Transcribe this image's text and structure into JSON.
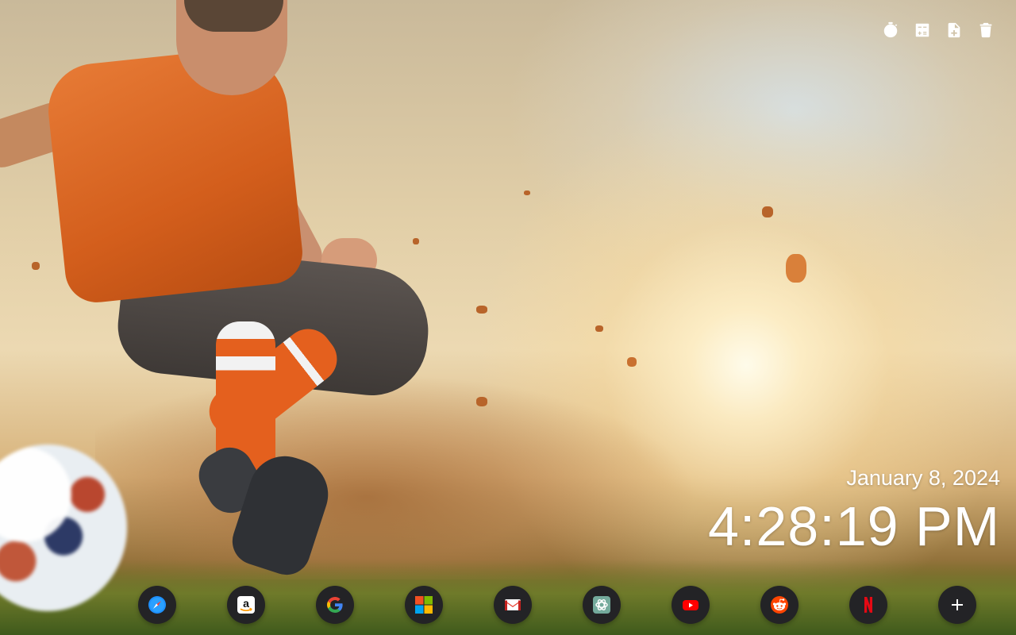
{
  "toolbar": {
    "items": [
      {
        "icon": "stopwatch-icon"
      },
      {
        "icon": "calculator-icon"
      },
      {
        "icon": "add-file-icon"
      },
      {
        "icon": "trash-icon"
      }
    ]
  },
  "clock": {
    "date": "January 8, 2024",
    "time": "4:28:19 PM"
  },
  "dock": {
    "items": [
      {
        "name": "safari",
        "icon": "compass-icon",
        "color": "#1e90ff"
      },
      {
        "name": "amazon",
        "icon": "amazon-icon",
        "color": "#ff9900"
      },
      {
        "name": "google",
        "icon": "google-icon",
        "color": "#4285f4"
      },
      {
        "name": "microsoft",
        "icon": "microsoft-icon",
        "color": "#f25022"
      },
      {
        "name": "gmail",
        "icon": "gmail-icon",
        "color": "#ea4335"
      },
      {
        "name": "chatgpt",
        "icon": "chatgpt-icon",
        "color": "#74aa9c"
      },
      {
        "name": "youtube",
        "icon": "youtube-icon",
        "color": "#ff0000"
      },
      {
        "name": "reddit",
        "icon": "reddit-icon",
        "color": "#ff4500"
      },
      {
        "name": "netflix",
        "icon": "netflix-icon",
        "color": "#e50914",
        "letter": "N"
      },
      {
        "name": "add",
        "icon": "plus-icon",
        "color": "#ffffff",
        "letter": "+"
      }
    ]
  }
}
